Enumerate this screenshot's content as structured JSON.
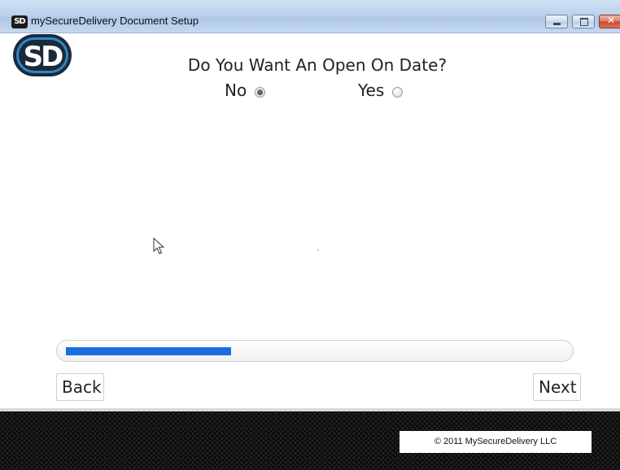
{
  "window": {
    "icon_text": "SD",
    "title": "mySecureDelivery Document Setup"
  },
  "logo": {
    "text": "SD",
    "colors": {
      "outer": "#1b2a3a",
      "ring": "#2f87c8",
      "inner": "#ffffff"
    }
  },
  "question": {
    "text": "Do You Want An Open On Date?",
    "options": [
      {
        "label": "No",
        "selected": true
      },
      {
        "label": "Yes",
        "selected": false
      }
    ]
  },
  "progress": {
    "fraction": 0.33,
    "color": "#1a6fe0"
  },
  "nav": {
    "back_label": "Back",
    "next_label": "Next"
  },
  "footer": {
    "copyright": "© 2011 MySecureDelivery LLC"
  }
}
